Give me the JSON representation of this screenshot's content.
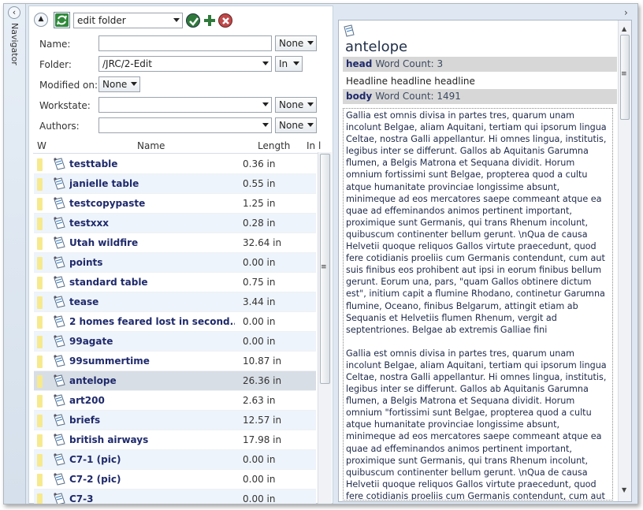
{
  "navigator": {
    "label": "Navigator"
  },
  "toolbar": {
    "folder_select": "edit folder"
  },
  "filters": {
    "name_label": "Name:",
    "name_value": "",
    "name_op": "None",
    "folder_label": "Folder:",
    "folder_value": "/JRC/2-Edit",
    "folder_op": "In",
    "modified_label": "Modified on:",
    "modified_op": "None",
    "workstate_label": "Workstate:",
    "workstate_value": "",
    "workstate_op": "None",
    "authors_label": "Authors:",
    "authors_value": "",
    "authors_op": "None"
  },
  "grid": {
    "columns": [
      "W",
      "Name",
      "Length",
      "In l"
    ],
    "rows": [
      {
        "name": "testtable",
        "length": "0.36 in"
      },
      {
        "name": "janielle table",
        "length": "0.55 in"
      },
      {
        "name": "testcopypaste",
        "length": "1.25 in"
      },
      {
        "name": "testxxx",
        "length": "0.28 in"
      },
      {
        "name": "Utah wildfire",
        "length": "32.64 in"
      },
      {
        "name": "points",
        "length": "0.00 in"
      },
      {
        "name": "standard table",
        "length": "0.75 in"
      },
      {
        "name": "tease",
        "length": "3.44 in"
      },
      {
        "name": "2 homes feared lost in second...",
        "length": "0.00 in"
      },
      {
        "name": "99agate",
        "length": "0.00 in"
      },
      {
        "name": "99summertime",
        "length": "10.87 in"
      },
      {
        "name": "antelope",
        "length": "26.36 in"
      },
      {
        "name": "art200",
        "length": "2.63 in"
      },
      {
        "name": "briefs",
        "length": "12.57 in"
      },
      {
        "name": "british airways",
        "length": "17.98 in"
      },
      {
        "name": "C7-1 (pic)",
        "length": "0.00 in"
      },
      {
        "name": "C7-2 (pic)",
        "length": "0.00 in"
      },
      {
        "name": "C7-3",
        "length": "0.00 in"
      }
    ],
    "selected_index": 11
  },
  "preview": {
    "title": "antelope",
    "head_label": "head",
    "head_count": "Word Count: 3",
    "head_text": "Headline headline headline",
    "body_label": "body",
    "body_count": "Word Count: 1491",
    "paragraphs": [
      "Gallia est omnis divisa in partes tres, quarum unam incolunt Belgae, aliam Aquitani, tertiam qui ipsorum lingua Celtae, nostra Galli appellantur. Hi omnes lingua, institutis, legibus inter se differunt. Gallos ab Aquitanis Garumna flumen, a Belgis Matrona et Sequana dividit. Horum omnium fortissimi sunt Belgae, propterea quod a cultu atque humanitate provinciae longissime absunt, minimeque ad eos mercatores saepe commeant atque ea quae ad effeminandos animos pertinent important, proximique sunt Germanis, qui trans Rhenum incolunt, quibuscum continenter bellum gerunt. \\nQua de causa Helvetii quoque reliquos Gallos virtute praecedunt, quod fere cotidianis proeliis cum Germanis contendunt, cum aut suis finibus eos prohibent aut ipsi in eorum finibus bellum gerunt. Eorum una, pars, \"quam Gallos obtinere dictum est\", initium capit a flumine Rhodano, continetur Garumna flumine, Oceano, finibus Belgarum, attingit etiam ab Sequanis et Helvetiis flumen Rhenum, vergit ad septentriones. Belgae ab extremis Galliae fini",
      "Gallia est omnis divisa in partes tres, quarum unam incolunt Belgae, aliam Aquitani, tertiam qui ipsorum lingua Celtae, nostra Galli appellantur. Hi omnes lingua, institutis, legibus inter se differunt. Gallos ab Aquitanis Garumna flumen, a Belgis Matrona et Sequana dividit. Horum omnium \"fortissimi sunt Belgae, propterea quod a cultu atque humanitate provinciae longissime absunt, minimeque ad eos mercatores saepe commeant atque ea quae ad effeminandos animos pertinent important, proximique sunt Germanis, qui trans Rhenum incolunt, quibuscum continenter bellum gerunt. \\nQua de causa Helvetii quoque reliquos Gallos virtute praecedunt, quod fere cotidianis proeliis cum Germanis contendunt, cum aut suis finibus eos prohibent aut ipsi in eorum finibus bellum gerunt. Eorum una,"
    ]
  },
  "icons": {
    "refresh": "refresh-icon",
    "apply": "check-icon",
    "add": "plus-icon",
    "delete": "delete-icon",
    "doc": "document-icon"
  },
  "colors": {
    "accent": "#1f2a6b",
    "selected_row": "#d8dee6",
    "alt_row": "#eef4fb",
    "folder": "#f7e98e"
  }
}
